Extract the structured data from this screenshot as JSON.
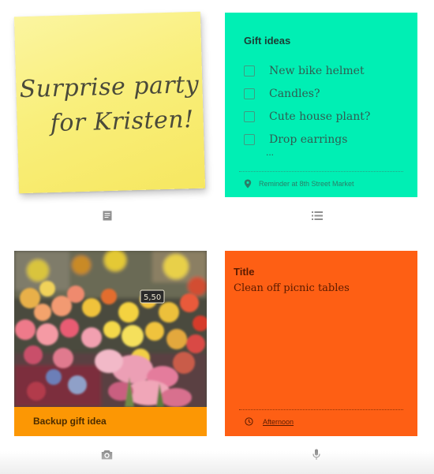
{
  "sticky_note": {
    "line1": "Surprise party",
    "line2": "for Kristen!",
    "color": "#f9ef7c"
  },
  "gift_note": {
    "title": "Gift ideas",
    "items": [
      {
        "label": "New bike helmet",
        "checked": false
      },
      {
        "label": "Candles?",
        "checked": false
      },
      {
        "label": "Cute house plant?",
        "checked": false
      },
      {
        "label": "Drop earrings",
        "checked": false
      }
    ],
    "more_indicator": "...",
    "reminder": "Reminder at 8th Street Market",
    "reminder_icon": "location-pin-icon",
    "color": "#00efb4"
  },
  "photo_note": {
    "caption": "Backup gift idea",
    "photo": "flower-market-photo",
    "color": "#fc9704"
  },
  "orange_note": {
    "title": "Title",
    "body": "Clean off picnic tables",
    "time_reminder": "Afternoon",
    "time_icon": "clock-icon",
    "color": "#fe5f14"
  },
  "type_icons": {
    "text_note": "text-note-icon",
    "list_note": "list-note-icon",
    "photo_note": "camera-icon",
    "voice_note": "microphone-icon"
  }
}
